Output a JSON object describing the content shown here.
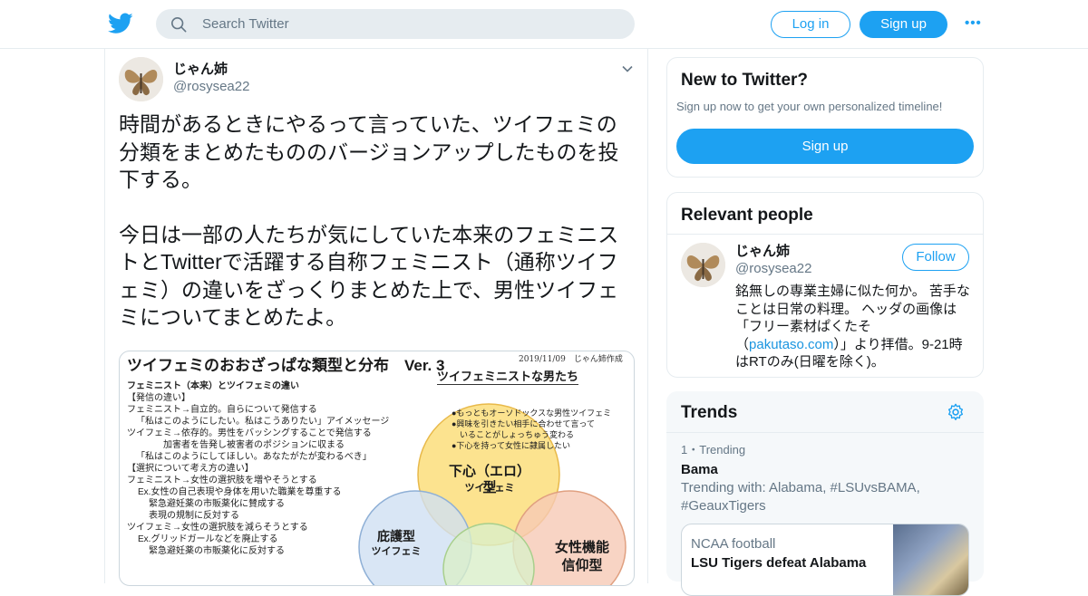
{
  "header": {
    "logo_icon": "twitter-bird-icon",
    "search_placeholder": "Search Twitter",
    "login_label": "Log in",
    "signup_label": "Sign up",
    "more_label": "•••"
  },
  "colors": {
    "accent": "#1da1f2",
    "text": "#14171a",
    "secondary_text": "#657786",
    "border": "#e6ecf0"
  },
  "tweet": {
    "name": "じゃん姉",
    "handle": "@rosysea22",
    "paragraph1": "時間があるときにやるって言っていた、ツイフェミの分類をまとめたもののバージョンアップしたものを投下する。",
    "paragraph2": "今日は一部の人たちが気にしていた本来のフェミニストとTwitterで活躍する自称フェミニスト（通称ツイフェミ）の違いをざっくりまとめた上で、男性ツイフェミについてまとめたよ。",
    "media": {
      "title": "ツイフェミのおおざっぱな類型と分布　Ver. 3",
      "date": "2019/11/09　じゃん姉作成",
      "subtitle": "ツイフェミニストな男たち",
      "lines": [
        "フェミニスト（本来）とツイフェミの違い",
        "【発信の違い】",
        "フェミニスト→自立的。自らについて発信する",
        "「私はこのようにしたい。私はこうありたい」アイメッセージ",
        "ツイフェミ→依存的。男性をバッシングすることで発信する",
        "加害者を告発し被害者のポジションに収まる",
        "「私はこのようにしてほしい。あなたがたが変わるべき」",
        "【選択について考え方の違い】",
        "フェミニスト→女性の選択肢を増やそうとする",
        "Ex.女性の自己表現や身体を用いた職業を尊重する",
        "緊急避妊薬の市販薬化に賛成する",
        "表現の規制に反対する",
        "ツイフェミ→女性の選択肢を減らそうとする",
        "Ex.グリッドガールなどを廃止する",
        "緊急避妊薬の市販薬化に反対する"
      ],
      "bullets": [
        "●もっともオーソドックスな男性ツイフェミ",
        "●興味を引きたい相手に合わせて言って",
        "　いることがしょっちゅう変わる",
        "●下心を持って女性に隷属したい"
      ],
      "circle_main_label": "下心（エロ）型",
      "circle_main_sub": "ツイフェミ",
      "circle_left_label": "庇護型",
      "circle_left_sub": "ツイフェミ",
      "circle_right_label": "女性機能",
      "circle_right_sub": "信仰型"
    }
  },
  "sidebar": {
    "new_to_twitter": {
      "title": "New to Twitter?",
      "subtitle": "Sign up now to get your own personalized timeline!",
      "button": "Sign up"
    },
    "relevant": {
      "title": "Relevant people",
      "name": "じゃん姉",
      "handle": "@rosysea22",
      "follow": "Follow",
      "bio_before": "銘無しの専業主婦に似た何か。 苦手なことは日常の料理。 ヘッダの画像は「フリー素材ぱくたそ（",
      "bio_link": "pakutaso.com",
      "bio_after": "）」より拝借。9-21時はRTのみ(日曜を除く)。"
    },
    "trends": {
      "title": "Trends",
      "settings_icon": "gear-icon",
      "rank": "1・Trending",
      "topic": "Bama",
      "trending_with": "Trending with: Alabama, #LSUvsBAMA, #GeauxTigers",
      "news_category": "NCAA football",
      "news_headline": "LSU Tigers defeat Alabama"
    }
  }
}
